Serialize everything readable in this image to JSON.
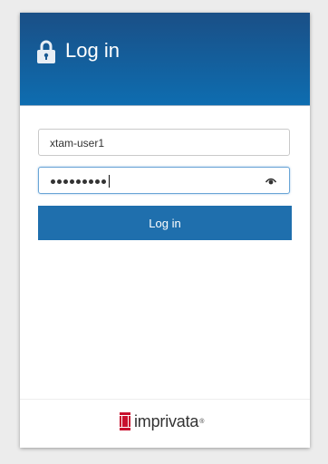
{
  "header": {
    "title": "Log in",
    "icon": "lock-icon"
  },
  "form": {
    "username_value": "xtam-user1",
    "password_mask": "•••••••••",
    "password_length": 9,
    "show_password_icon": "eye-icon",
    "submit_label": "Log in"
  },
  "footer": {
    "brand_name": "imprivata",
    "brand_tm": "®"
  },
  "colors": {
    "header_top": "#1a4f86",
    "header_bottom": "#0e6db0",
    "button": "#1f6fad",
    "brand_red": "#c8102e"
  }
}
